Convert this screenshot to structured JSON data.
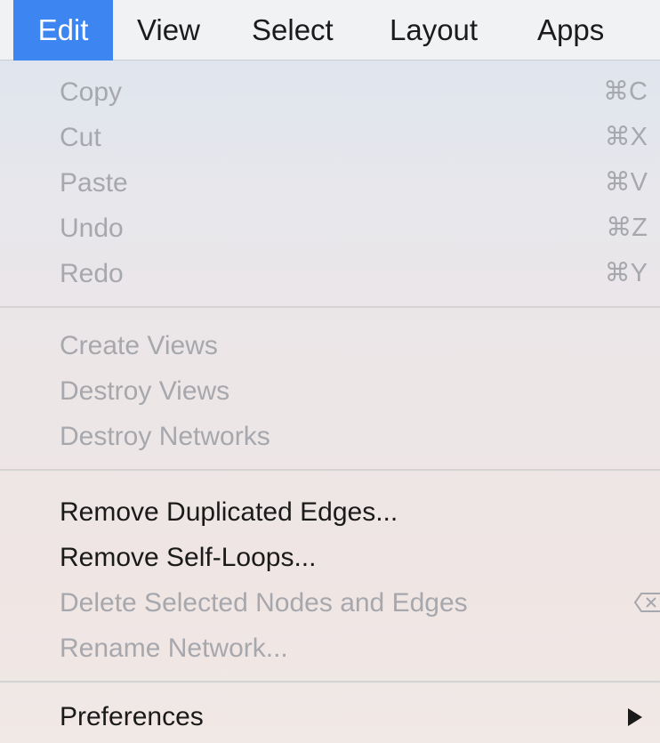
{
  "menubar": {
    "items": [
      {
        "label": "Edit",
        "active": true
      },
      {
        "label": "View"
      },
      {
        "label": "Select"
      },
      {
        "label": "Layout"
      },
      {
        "label": "Apps"
      }
    ]
  },
  "edit_menu": {
    "group1": [
      {
        "label": "Copy",
        "shortcut": "⌘C",
        "enabled": false
      },
      {
        "label": "Cut",
        "shortcut": "⌘X",
        "enabled": false
      },
      {
        "label": "Paste",
        "shortcut": "⌘V",
        "enabled": false
      },
      {
        "label": "Undo",
        "shortcut": "⌘Z",
        "enabled": false
      },
      {
        "label": "Redo",
        "shortcut": "⌘Y",
        "enabled": false
      }
    ],
    "group2": [
      {
        "label": "Create Views",
        "enabled": false
      },
      {
        "label": "Destroy Views",
        "enabled": false
      },
      {
        "label": "Destroy Networks",
        "enabled": false
      }
    ],
    "group3": [
      {
        "label": "Remove Duplicated Edges...",
        "enabled": true
      },
      {
        "label": "Remove Self-Loops...",
        "enabled": true
      },
      {
        "label": "Delete Selected Nodes and Edges",
        "shortcut_icon": "delete-key-icon",
        "enabled": false
      },
      {
        "label": "Rename Network...",
        "enabled": false
      }
    ],
    "group4": [
      {
        "label": "Preferences",
        "submenu_icon": "submenu-arrow-icon",
        "enabled": true
      }
    ]
  },
  "colors": {
    "menubar_highlight": "#3d86f2",
    "disabled_text": "#a7a8ad",
    "enabled_text": "#1a1a1a"
  }
}
